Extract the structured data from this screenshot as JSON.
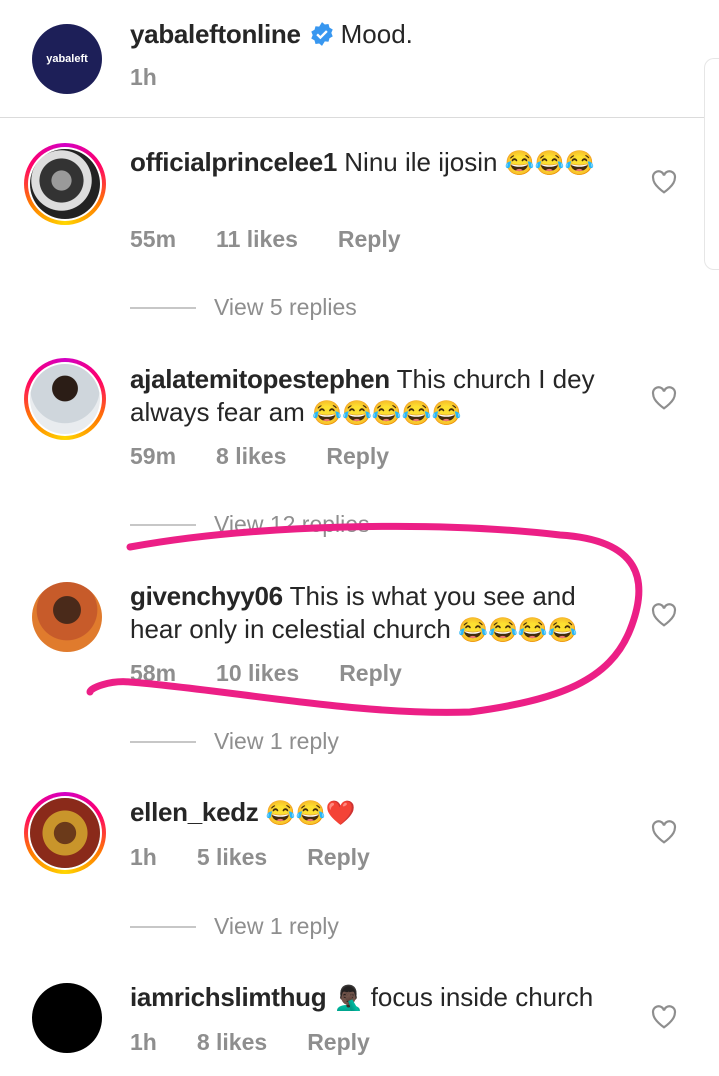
{
  "post": {
    "username": "yabaleftonline",
    "caption": "Mood.",
    "time": "1h",
    "avatar_text": "yabaleft"
  },
  "comments": [
    {
      "username": "officialprincelee1",
      "text": "Ninu ile ijosin",
      "emojis": "😂😂😂",
      "time": "55m",
      "likes": "11 likes",
      "reply": "Reply",
      "view_replies": "View 5 replies"
    },
    {
      "username": "ajalatemitopestephen",
      "text": "This church I dey always fear am",
      "emojis": "😂😂😂😂😂",
      "time": "59m",
      "likes": "8 likes",
      "reply": "Reply",
      "view_replies": "View 12 replies"
    },
    {
      "username": "givenchyy06",
      "text": "This is what you see and hear only in celestial church",
      "emojis": "😂😂😂😂",
      "time": "58m",
      "likes": "10 likes",
      "reply": "Reply",
      "view_replies": "View 1 reply"
    },
    {
      "username": "ellen_kedz",
      "text": "",
      "emojis": "😂😂❤️",
      "time": "1h",
      "likes": "5 likes",
      "reply": "Reply",
      "view_replies": "View 1 reply"
    },
    {
      "username": "iamrichslimthug",
      "text": "focus inside church",
      "emojis": "🤦🏿‍♂️",
      "time": "1h",
      "likes": "8 likes",
      "reply": "Reply"
    }
  ],
  "colors": {
    "text": "#262626",
    "meta": "#8e8e8e",
    "verified": "#3897f0",
    "highlight": "#ec1f86"
  }
}
